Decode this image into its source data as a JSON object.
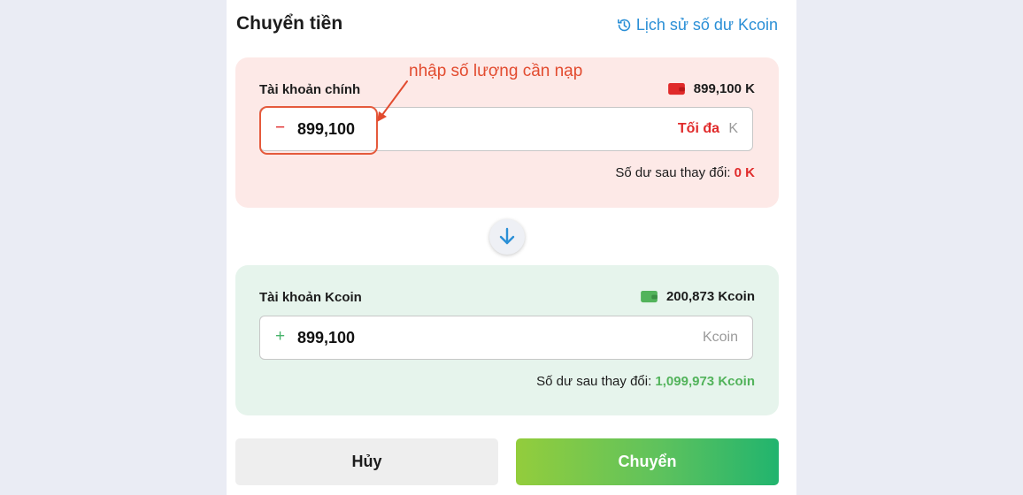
{
  "header": {
    "title": "Chuyển tiền",
    "history_link": "Lịch sử số dư Kcoin"
  },
  "main_account": {
    "label": "Tài khoản chính",
    "balance": "899,100 K",
    "sign": "−",
    "amount": "899,100",
    "max_label": "Tối đa",
    "unit": "K",
    "after_label": "Số dư sau thay đổi:",
    "after_value": "0 K"
  },
  "kcoin_account": {
    "label": "Tài khoản Kcoin",
    "balance": "200,873 Kcoin",
    "sign": "+",
    "amount": "899,100",
    "unit": "Kcoin",
    "after_label": "Số dư sau thay đổi:",
    "after_value": "1,099,973 Kcoin"
  },
  "annotation": {
    "text": "nhập số lượng cần nạp",
    "color": "#e24b2f"
  },
  "icons": {
    "history": "history-icon",
    "wallet_main": "wallet-icon",
    "wallet_kcoin": "wallet-icon",
    "swap": "arrow-down-icon"
  },
  "colors": {
    "accent_blue": "#2a8fd6",
    "danger_red": "#e02a2a",
    "success_green": "#52b35b",
    "main_card_bg": "#fde9e7",
    "kcoin_card_bg": "#e6f4ec"
  },
  "actions": {
    "cancel": "Hủy",
    "transfer": "Chuyển"
  }
}
